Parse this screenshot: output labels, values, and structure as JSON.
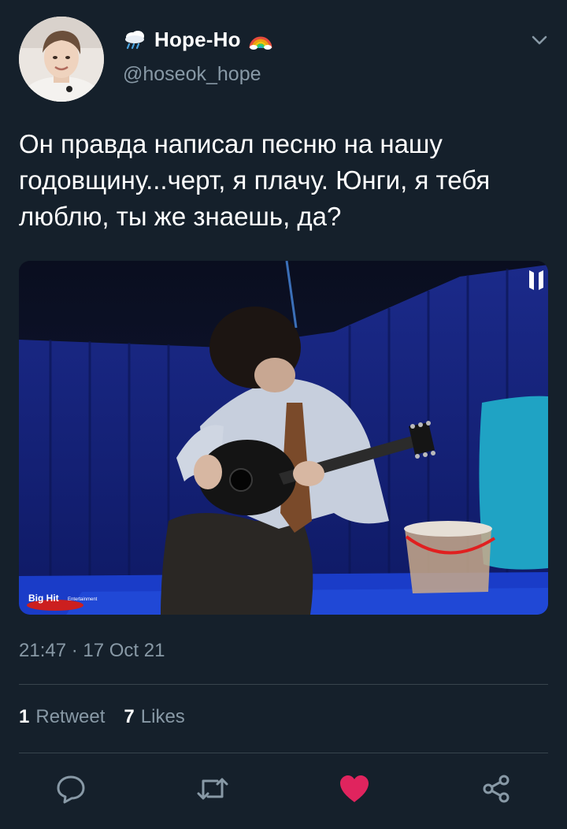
{
  "author": {
    "display_name": "Hope-Ho",
    "handle": "@hoseok_hope",
    "name_prefix_icon": "cloud-rain-snow-emoji-icon",
    "name_suffix_icon": "rainbow-emoji-icon",
    "avatar_icon": "user-avatar-photo"
  },
  "tweet": {
    "text": "Он правда написал песню на нашу годовщину...черт, я плачу. Юнги, я тебя люблю, ты же знаешь, да?",
    "timestamp": "21:47 · 17 Oct 21"
  },
  "media": {
    "watermark_logo": "BigHit Entertainment",
    "corner_logo_icon": "bts-logo-icon"
  },
  "stats": {
    "retweets_count": "1",
    "retweets_label": "Retweet",
    "likes_count": "7",
    "likes_label": "Likes"
  },
  "actions": {
    "reply_icon": "reply-bubble-icon",
    "retweet_icon": "retweet-icon",
    "like_icon": "heart-icon",
    "share_icon": "share-icon"
  },
  "colors": {
    "background": "#15202b",
    "secondary_text": "#8899a6",
    "divider": "#38444d",
    "like_active": "#e0245e"
  }
}
